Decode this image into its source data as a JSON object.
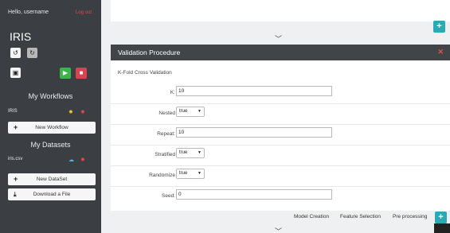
{
  "sidebar": {
    "greeting": "Hello, username",
    "logout": "Log out",
    "brand": "IRIS",
    "undo_icon": "undo-icon",
    "redo_icon": "redo-icon",
    "save_icon": "save-icon",
    "play_icon": "play-icon",
    "stop_icon": "stop-icon",
    "workflows_title": "My Workflows",
    "workflows": [
      {
        "name": "IRIS"
      }
    ],
    "new_workflow": "New Workflow",
    "datasets_title": "My Datasets",
    "datasets": [
      {
        "name": "iris.csv"
      }
    ],
    "new_dataset": "New DataSet",
    "download_file": "Download a File"
  },
  "panel": {
    "title": "Validation Procedure",
    "close_icon": "close-icon",
    "subtitle": "K-Fold Cross Validation",
    "fields": {
      "k": {
        "label": "K:",
        "value": "10"
      },
      "nested": {
        "label": "Nested",
        "value": "true"
      },
      "repeat": {
        "label": "Repeat:",
        "value": "10"
      },
      "stratified": {
        "label": "Stratified",
        "value": "true"
      },
      "randomize": {
        "label": "Randomize",
        "value": "true"
      },
      "seed": {
        "label": "Seed:",
        "value": "0"
      }
    }
  },
  "tabs": [
    "Model Creation",
    "Feature Selection",
    "Pre processing"
  ],
  "colors": {
    "sidebar_bg": "#3b3f43",
    "panel_header_bg": "#414548",
    "teal": "#2aa9b6",
    "green": "#3ab54a",
    "red": "#d9434f"
  }
}
